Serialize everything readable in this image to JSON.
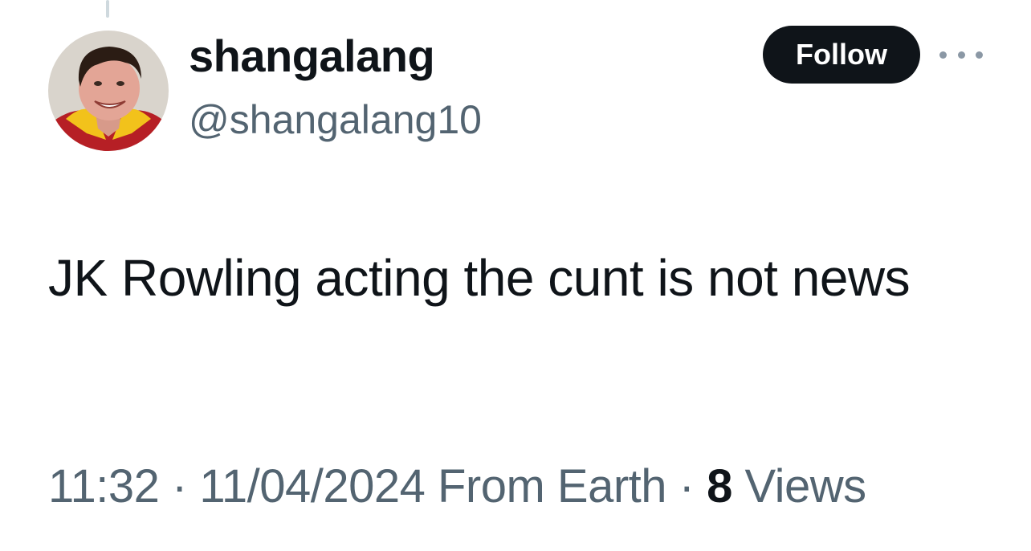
{
  "tweet": {
    "author": {
      "display_name": "shangalang",
      "handle": "@shangalang10",
      "avatar_icon": "profile-photo"
    },
    "follow_label": "Follow",
    "more_icon": "more-horizontal-icon",
    "text": "JK Rowling acting the cunt is not news",
    "time": "11:32",
    "separator": " · ",
    "date": "11/04/2024",
    "source": "From Earth",
    "views_count": "8",
    "views_label": "Views"
  },
  "colors": {
    "text_primary": "#0f1419",
    "text_secondary": "#536471",
    "follow_button_bg": "#0f1419",
    "follow_button_text": "#ffffff",
    "thread_line": "#cfd9de"
  }
}
